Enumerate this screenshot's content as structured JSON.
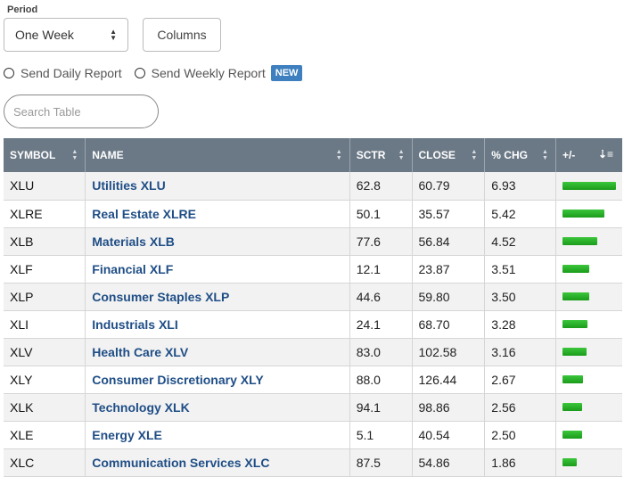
{
  "controls": {
    "period_label": "Period",
    "period_value": "One Week",
    "columns_label": "Columns",
    "send_daily": "Send Daily Report",
    "send_weekly": "Send Weekly Report",
    "new_badge": "NEW",
    "search_placeholder": "Search Table"
  },
  "table": {
    "headers": [
      "SYMBOL",
      "NAME",
      "SCTR",
      "CLOSE",
      "% CHG",
      "+/-"
    ],
    "rows": [
      {
        "symbol": "XLU",
        "name": "Utilities XLU",
        "sctr": "62.8",
        "close": "60.79",
        "chg": "6.93",
        "pct": 6.93
      },
      {
        "symbol": "XLRE",
        "name": "Real Estate XLRE",
        "sctr": "50.1",
        "close": "35.57",
        "chg": "5.42",
        "pct": 5.42
      },
      {
        "symbol": "XLB",
        "name": "Materials XLB",
        "sctr": "77.6",
        "close": "56.84",
        "chg": "4.52",
        "pct": 4.52
      },
      {
        "symbol": "XLF",
        "name": "Financial XLF",
        "sctr": "12.1",
        "close": "23.87",
        "chg": "3.51",
        "pct": 3.51
      },
      {
        "symbol": "XLP",
        "name": "Consumer Staples XLP",
        "sctr": "44.6",
        "close": "59.80",
        "chg": "3.50",
        "pct": 3.5
      },
      {
        "symbol": "XLI",
        "name": "Industrials XLI",
        "sctr": "24.1",
        "close": "68.70",
        "chg": "3.28",
        "pct": 3.28
      },
      {
        "symbol": "XLV",
        "name": "Health Care XLV",
        "sctr": "83.0",
        "close": "102.58",
        "chg": "3.16",
        "pct": 3.16
      },
      {
        "symbol": "XLY",
        "name": "Consumer Discretionary XLY",
        "sctr": "88.0",
        "close": "126.44",
        "chg": "2.67",
        "pct": 2.67
      },
      {
        "symbol": "XLK",
        "name": "Technology XLK",
        "sctr": "94.1",
        "close": "98.86",
        "chg": "2.56",
        "pct": 2.56
      },
      {
        "symbol": "XLE",
        "name": "Energy XLE",
        "sctr": "5.1",
        "close": "40.54",
        "chg": "2.50",
        "pct": 2.5
      },
      {
        "symbol": "XLC",
        "name": "Communication Services XLC",
        "sctr": "87.5",
        "close": "54.86",
        "chg": "1.86",
        "pct": 1.86
      }
    ]
  },
  "colors": {
    "header_bg": "#6b7986",
    "name_link": "#1f4e86",
    "bar_green": "#2db82d",
    "new_badge": "#3d7fbf"
  }
}
